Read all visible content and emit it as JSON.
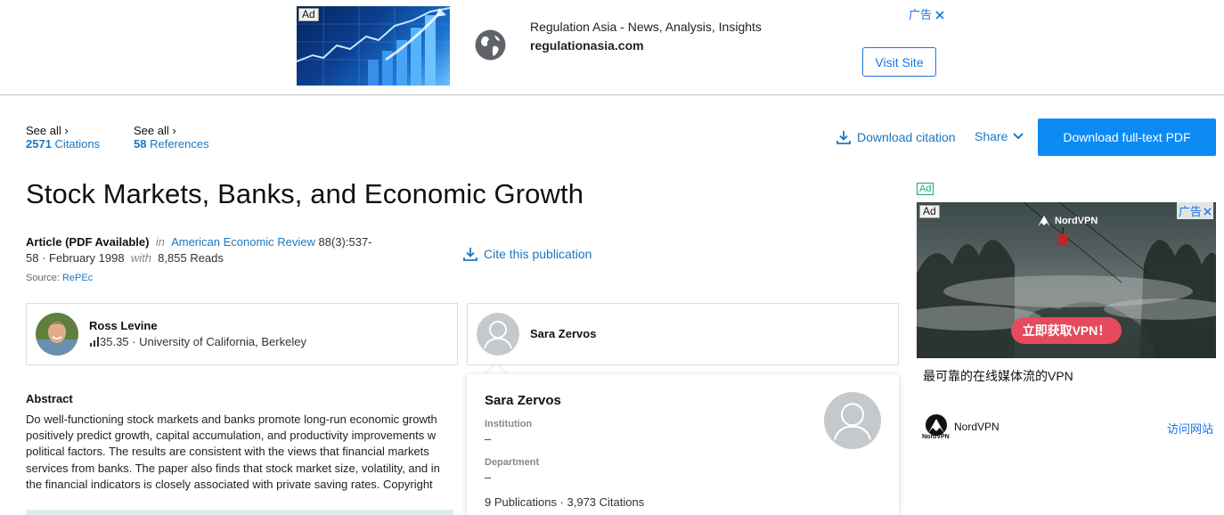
{
  "top_ad": {
    "badge": "Ad",
    "title": "Regulation Asia - News, Analysis, Insights",
    "domain": "regulationasia.com",
    "choices": "广告",
    "visit_label": "Visit Site"
  },
  "stats": {
    "citations": {
      "see_all": "See all ›",
      "count": "2571",
      "label": "Citations"
    },
    "references": {
      "see_all": "See all ›",
      "count": "58",
      "label": "References"
    }
  },
  "actions": {
    "download_citation": "Download citation",
    "share": "Share",
    "download_pdf": "Download full-text PDF",
    "cite": "Cite this publication"
  },
  "article": {
    "title": "Stock Markets, Banks, and Economic Growth",
    "type": "Article (PDF Available)",
    "in": "in",
    "journal": "American Economic Review",
    "volume": "88(3):537-",
    "pages_date": "58 · February 1998",
    "with": "with",
    "reads": "8,855 Reads",
    "source_label": "Source:",
    "source": "RePEc"
  },
  "authors": [
    {
      "name": "Ross Levine",
      "score": "35.35",
      "affiliation": "· University of California, Berkeley"
    },
    {
      "name": "Sara Zervos"
    }
  ],
  "abstract": {
    "heading": "Abstract",
    "lines": [
      "Do well-functioning stock markets and banks promote long-run economic growth",
      "positively predict growth, capital accumulation, and productivity improvements w",
      "political factors. The results are consistent with the views that financial markets",
      "services from banks. The paper also finds that stock market size, volatility, and in",
      "the financial indicators is closely associated with private saving rates. Copyright"
    ]
  },
  "popup": {
    "name": "Sara Zervos",
    "institution_label": "Institution",
    "institution": "–",
    "department_label": "Department",
    "department": "–",
    "stats": "9 Publications · 3,973 Citations"
  },
  "right_ad": {
    "label": "Ad",
    "badge": "Ad",
    "choices": "广告",
    "brand": "NordVPN",
    "cta": "立即获取VPN！",
    "caption": "最可靠的在线媒体流的VPN",
    "advertiser": "NordVPN",
    "advertiser_small": "NordVPN",
    "visit": "访问网站"
  },
  "colors": {
    "accent": "#0c8bf5",
    "link": "#1a78c2",
    "ad_link": "#1a73e8",
    "cta": "#e54b5c"
  }
}
